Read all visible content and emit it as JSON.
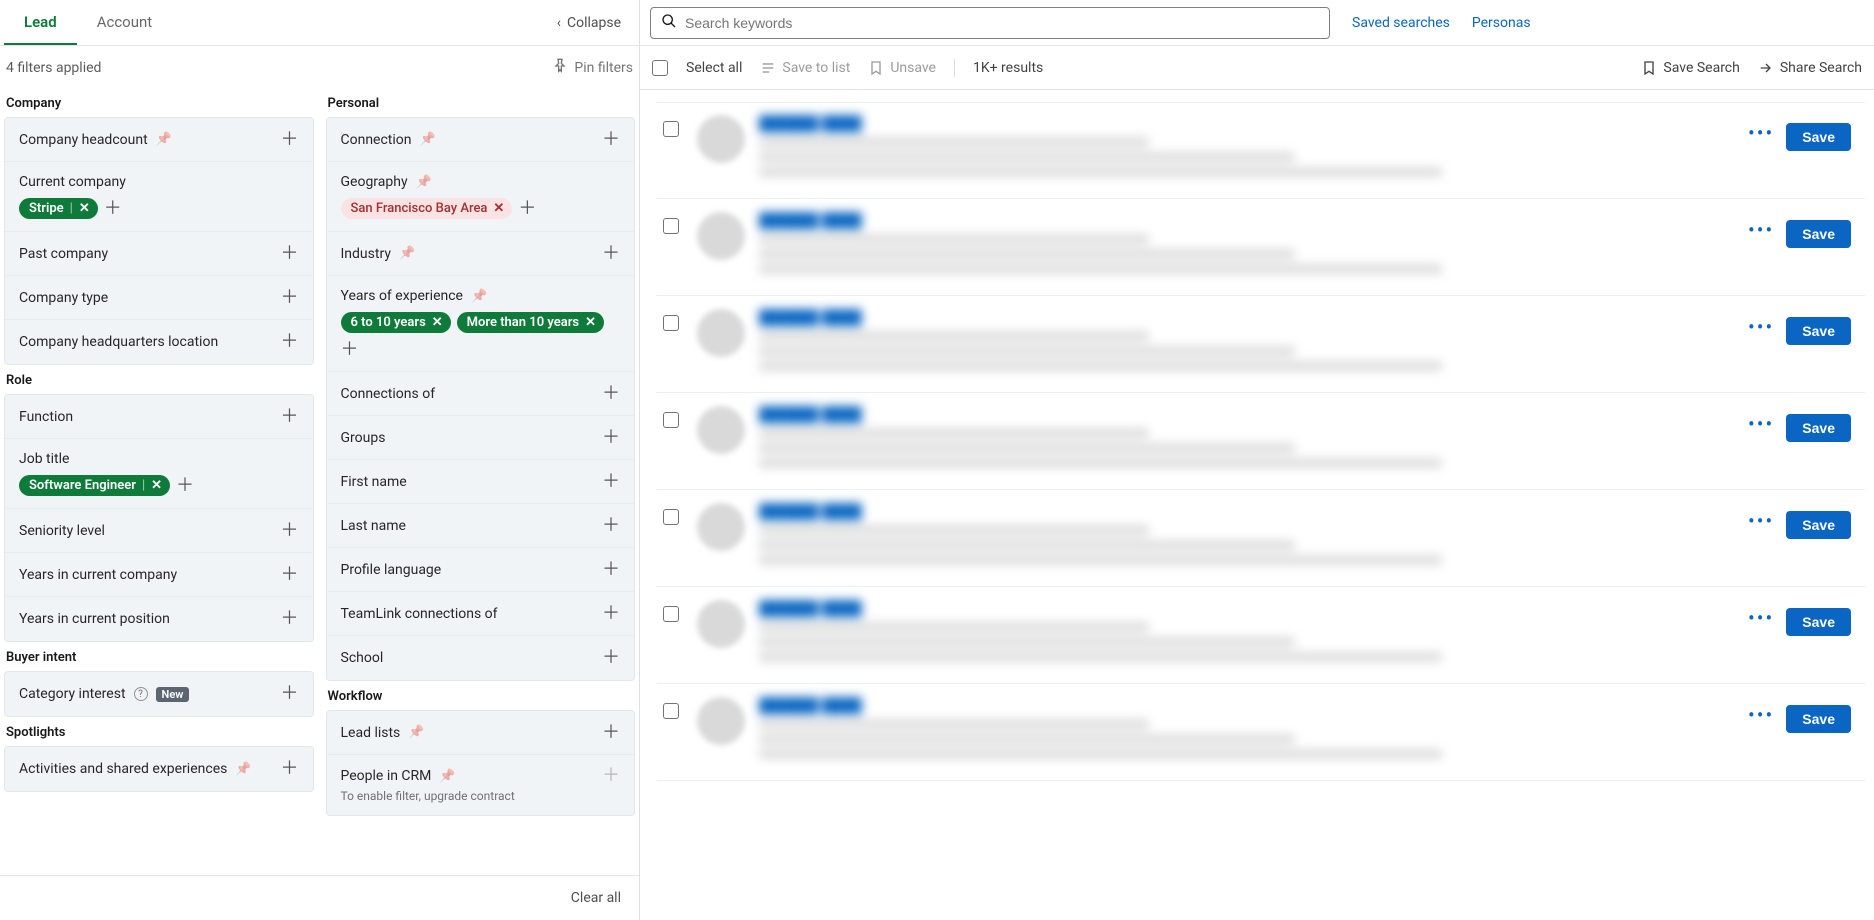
{
  "tabs": {
    "lead": "Lead",
    "account": "Account"
  },
  "collapse": "Collapse",
  "filtersApplied": "4 filters applied",
  "pinFilters": "Pin filters",
  "clearAll": "Clear all",
  "sections": {
    "company": "Company",
    "role": "Role",
    "buyerIntent": "Buyer intent",
    "spotlights": "Spotlights",
    "personal": "Personal",
    "workflow": "Workflow"
  },
  "filters": {
    "companyHeadcount": "Company headcount",
    "currentCompany": "Current company",
    "pastCompany": "Past company",
    "companyType": "Company type",
    "companyHQ": "Company headquarters location",
    "function": "Function",
    "jobTitle": "Job title",
    "seniority": "Seniority level",
    "yearsCurrentCompany": "Years in current company",
    "yearsCurrentPosition": "Years in current position",
    "categoryInterest": "Category interest",
    "activities": "Activities and shared experiences",
    "connection": "Connection",
    "geography": "Geography",
    "industry": "Industry",
    "yearsExperience": "Years of experience",
    "connectionsOf": "Connections of",
    "groups": "Groups",
    "firstName": "First name",
    "lastName": "Last name",
    "profileLanguage": "Profile language",
    "teamlink": "TeamLink connections of",
    "school": "School",
    "leadLists": "Lead lists",
    "peopleInCRM": "People in CRM",
    "peopleInCRMSub": "To enable filter, upgrade contract"
  },
  "badges": {
    "new": "New"
  },
  "chips": {
    "stripe": "Stripe",
    "softwareEngineer": "Software Engineer",
    "sfBay": "San Francisco Bay Area",
    "years6to10": "6 to 10 years",
    "yearsMore10": "More than 10 years"
  },
  "search": {
    "placeholder": "Search keywords",
    "savedSearches": "Saved searches",
    "personas": "Personas"
  },
  "toolbar": {
    "selectAll": "Select all",
    "saveToList": "Save to list",
    "unsave": "Unsave",
    "resultsCount": "1K+ results",
    "saveSearch": "Save Search",
    "shareSearch": "Share Search"
  },
  "result": {
    "save": "Save"
  },
  "resultCount": 7
}
